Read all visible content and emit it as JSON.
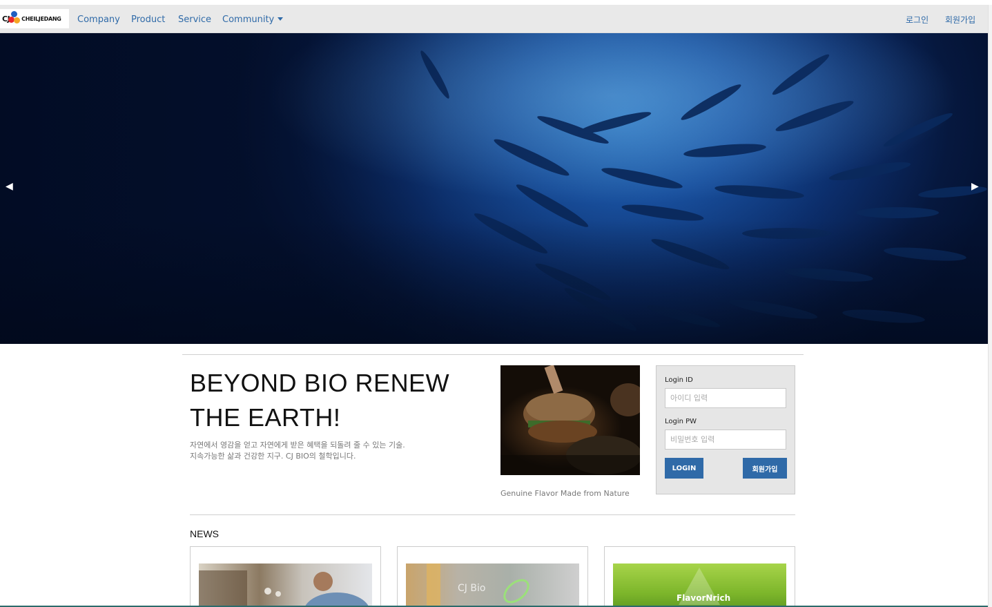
{
  "brand": {
    "logo_cj": "CJ",
    "logo_text": "CHEILJEDANG"
  },
  "nav": {
    "items": [
      "Company",
      "Product",
      "Service",
      "Community"
    ],
    "right": {
      "login": "로그인",
      "signup": "회원가입"
    }
  },
  "hero": {
    "prev": "◀",
    "next": "▶"
  },
  "intro": {
    "headline_line1": "BEYOND BIO RENEW",
    "headline_line2": "THE EARTH!",
    "sub_line1": "자연에서 영감을 얻고 자연에게 받은 혜택을 되돌려 줄 수 있는 기술.",
    "sub_line2": "지속가능한 삶과 건강한 지구. CJ BIO의 철학입니다."
  },
  "feature": {
    "caption": "Genuine Flavor Made from Nature"
  },
  "login": {
    "id_label": "Login ID",
    "id_placeholder": "아이디 입력",
    "pw_label": "Login PW",
    "pw_placeholder": "비밀번호 입력",
    "login_button": "LOGIN",
    "signup_button": "회원가입"
  },
  "news": {
    "title": "NEWS",
    "cards": [
      {
        "image": "kitchen-man-photo"
      },
      {
        "image": "cj-bio-sign-photo",
        "logo_text": "CJ Bio"
      },
      {
        "image": "flavornrich-green-photo",
        "logo_text": "FlavorNrich"
      }
    ]
  },
  "colors": {
    "nav_link": "#2f6aa8",
    "button": "#2f6aa8",
    "navbar_bg": "#e9e9e9"
  }
}
